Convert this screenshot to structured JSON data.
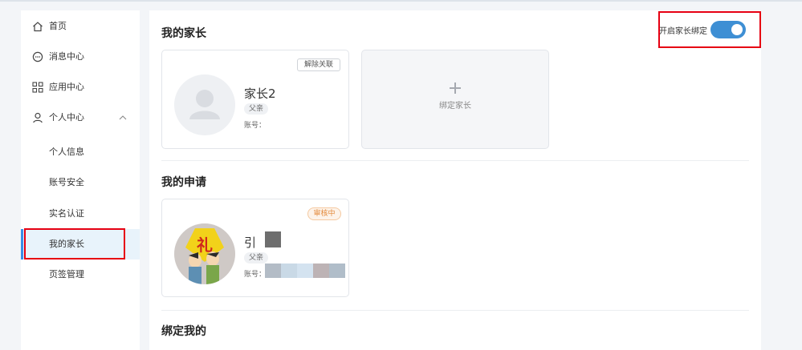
{
  "sidebar": {
    "items": [
      {
        "label": "首页",
        "icon": "home-icon"
      },
      {
        "label": "消息中心",
        "icon": "message-icon"
      },
      {
        "label": "应用中心",
        "icon": "apps-icon"
      },
      {
        "label": "个人中心",
        "icon": "user-icon"
      }
    ],
    "sub_items": [
      {
        "label": "个人信息"
      },
      {
        "label": "账号安全"
      },
      {
        "label": "实名认证"
      },
      {
        "label": "我的家长"
      },
      {
        "label": "页签管理"
      }
    ]
  },
  "main": {
    "my_parents": {
      "title": "我的家长",
      "toggle_label": "开启家长绑定",
      "toggle_on": true,
      "card": {
        "name": "家长2",
        "relation": "父亲",
        "account_label": "账号：",
        "unbind_label": "解除关联"
      },
      "add_label": "绑定家长"
    },
    "my_requests": {
      "title": "我的申请",
      "card": {
        "name": "引",
        "relation": "父亲",
        "account_label": "账号：",
        "status": "审核中"
      }
    },
    "bound_me": {
      "title": "绑定我的"
    }
  },
  "colors": {
    "accent": "#3e8fd4",
    "highlight_box": "#e60012",
    "status_orange": "#e38a3c"
  }
}
